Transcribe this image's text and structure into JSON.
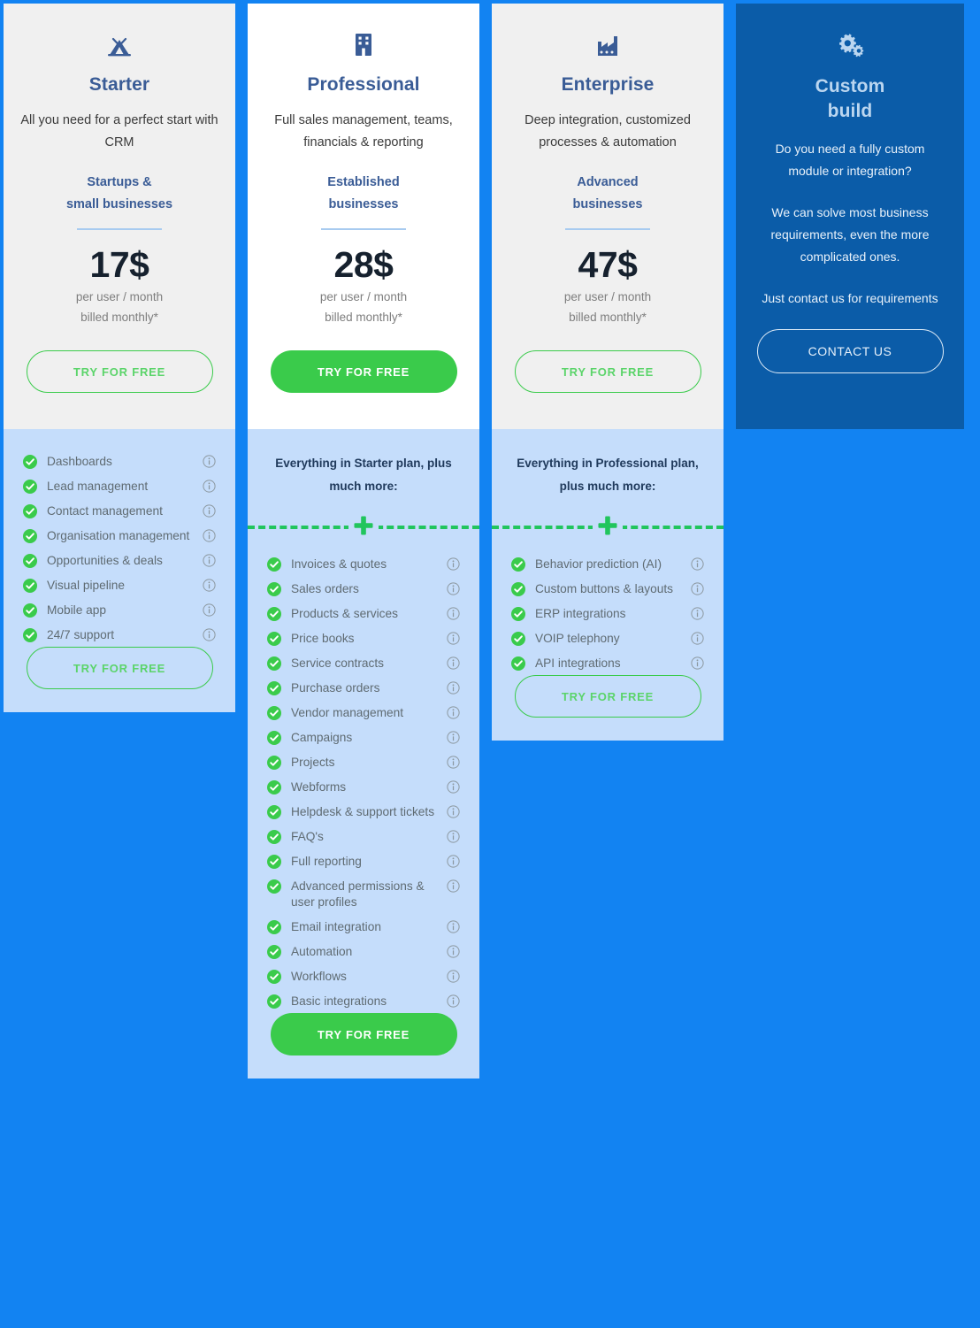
{
  "theme": {
    "page_bg": "#1283F2",
    "card_gray": "#F0F0F0",
    "card_white": "#FFFFFF",
    "features_bg": "#C5DDFB",
    "custom_bg": "#0B5CA8",
    "accent_green": "#3ACB4B",
    "heading_blue": "#3A5C96"
  },
  "plans": [
    {
      "id": "starter",
      "icon": "tent-icon",
      "name": "Starter",
      "description": "All you need for a perfect start with CRM",
      "audience": "Startups &\nsmall businesses",
      "audience_line1": "Startups &",
      "audience_line2": "small businesses",
      "price": "17$",
      "price_note_line1": "per user / month",
      "price_note_line2": "billed monthly*",
      "cta_label": "TRY FOR FREE",
      "cta_style": "ghost",
      "features_header": "",
      "features_header_bold": "",
      "features_header_tail": "",
      "features": [
        "Dashboards",
        "Lead management",
        "Contact management",
        "Organisation management",
        "Opportunities & deals",
        "Visual pipeline",
        "Mobile app",
        "24/7 support"
      ],
      "bottom_cta_label": "TRY FOR FREE",
      "bottom_cta_style": "ghost"
    },
    {
      "id": "professional",
      "icon": "office-building-icon",
      "name": "Professional",
      "description": "Full sales management, teams, financials & reporting",
      "audience_line1": "Established",
      "audience_line2": "businesses",
      "price": "28$",
      "price_note_line1": "per user / month",
      "price_note_line2": "billed monthly*",
      "cta_label": "TRY FOR FREE",
      "cta_style": "solid",
      "features_header_lead": "Everything in ",
      "features_header_bold": "Starter",
      "features_header_tail": " plan, plus much more:",
      "features": [
        "Invoices & quotes",
        "Sales orders",
        "Products & services",
        "Price books",
        "Service contracts",
        "Purchase orders",
        "Vendor management",
        "Campaigns",
        "Projects",
        "Webforms",
        "Helpdesk & support tickets",
        "FAQ's",
        "Full reporting",
        "Advanced permissions & user profiles",
        "Email integration",
        "Automation",
        "Workflows",
        "Basic integrations"
      ],
      "bottom_cta_label": "TRY FOR FREE",
      "bottom_cta_style": "solid"
    },
    {
      "id": "enterprise",
      "icon": "factory-icon",
      "name": "Enterprise",
      "description": "Deep integration, customized processes & automation",
      "audience_line1": "Advanced",
      "audience_line2": "businesses",
      "price": "47$",
      "price_note_line1": "per user / month",
      "price_note_line2": "billed monthly*",
      "cta_label": "TRY FOR FREE",
      "cta_style": "ghost",
      "features_header_lead": "Everything in ",
      "features_header_bold": "Professional",
      "features_header_tail": " plan, plus much more:",
      "features": [
        "Behavior prediction (AI)",
        "Custom buttons & layouts",
        "ERP integrations",
        "VOIP telephony",
        "API integrations"
      ],
      "bottom_cta_label": "TRY FOR FREE",
      "bottom_cta_style": "ghost"
    }
  ],
  "custom": {
    "icon": "gears-icon",
    "name_line1": "Custom",
    "name_line2": "build",
    "paragraph1": "Do you need a fully custom module or integration?",
    "paragraph2": "We can solve most business requirements, even the more complicated ones.",
    "paragraph3": "Just contact us for requirements",
    "cta_label": "CONTACT US"
  },
  "icons": {
    "check": "check-circle-icon",
    "info": "info-icon",
    "plus": "plus-icon"
  }
}
